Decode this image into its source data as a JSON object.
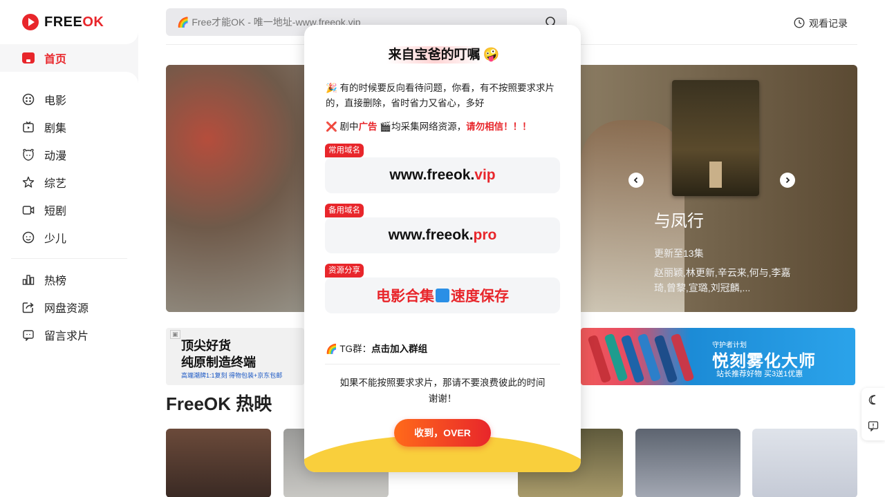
{
  "brand": {
    "logo_text_a": "FREE",
    "logo_text_b": "OK"
  },
  "sidebar": {
    "home_label": "首页",
    "items": [
      {
        "label": "电影",
        "icon": "film-reel-icon"
      },
      {
        "label": "剧集",
        "icon": "tv-icon"
      },
      {
        "label": "动漫",
        "icon": "bear-icon"
      },
      {
        "label": "综艺",
        "icon": "star-icon"
      },
      {
        "label": "短剧",
        "icon": "camera-icon"
      },
      {
        "label": "少儿",
        "icon": "smile-icon"
      }
    ],
    "items2": [
      {
        "label": "热榜",
        "icon": "chart-icon"
      },
      {
        "label": "网盘资源",
        "icon": "share-icon"
      },
      {
        "label": "留言求片",
        "icon": "message-icon"
      }
    ]
  },
  "header": {
    "search_placeholder": "🌈 Free才能OK - 唯一地址-www.freeok.vip",
    "history_label": "观看记录"
  },
  "banner": {
    "title": "与凤行",
    "update": "更新至13集",
    "cast": "赵丽颖,林更新,辛云来,何与,李嘉琦,曾黎,宣璐,刘冠麟,..."
  },
  "ads": {
    "left_line1": "顶尖好货",
    "left_line2": "纯原制造终端",
    "left_line3": "高端潮牌1:1复刻  得物包装+京东包邮",
    "right_line0": "守护者计划",
    "right_line1": "悦刻雾化大师",
    "right_line2": "站长推荐好物  买3送1优惠"
  },
  "section": {
    "title": "FreeOK 热映"
  },
  "modal": {
    "title": "来自宝爸的叮嘱",
    "title_emoji": "🤪",
    "p1": "🎉 有的时候要反向看待问题，你看，有不按照要求求片的，直接删除，省时省力又省心，多好",
    "p2_prefix": "❌ 剧中",
    "p2_ad": "广告",
    "p2_mid": " 🎬均采集网络资源，",
    "p2_warn": "请勿相信！！！",
    "domains": [
      {
        "tag": "常用域名",
        "prefix": "www.freeok.",
        "suffix": "vip"
      },
      {
        "tag": "备用域名",
        "prefix": "www.freeok.",
        "suffix": "pro"
      }
    ],
    "share_tag": "资源分享",
    "share_a": "电影合集",
    "share_b": "速度保存",
    "tg_prefix": "🌈 TG群：",
    "tg_link": "点击加入群组",
    "note_line1": "如果不能按照要求求片，那请不要浪费彼此的时间",
    "note_line2": "谢谢！",
    "ok_label": "收到，OVER"
  },
  "colors": {
    "accent": "#e8262b",
    "wave": "#f9cf3c"
  }
}
